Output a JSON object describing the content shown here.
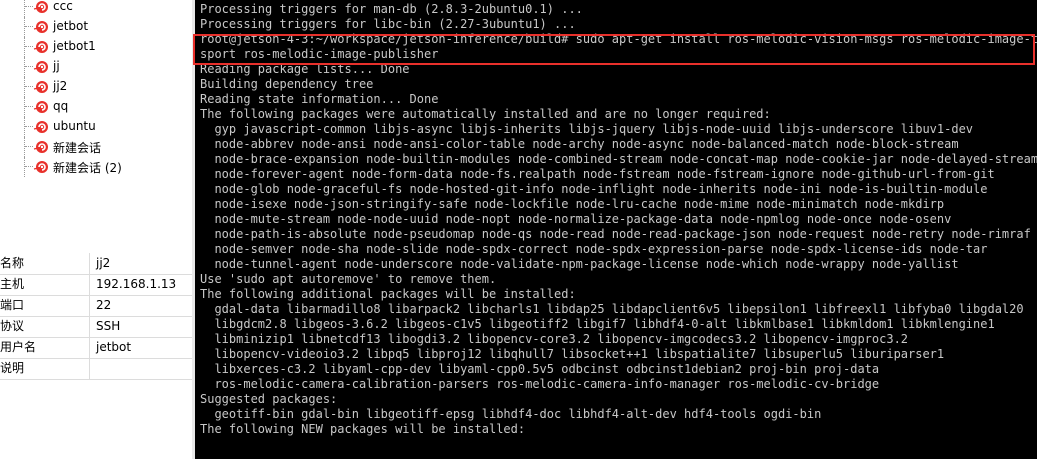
{
  "sidebar": {
    "sessions": [
      "ccc",
      "jetbot",
      "jetbot1",
      "jj",
      "jj2",
      "qq",
      "ubuntu",
      "新建会话",
      "新建会话 (2)"
    ]
  },
  "properties": [
    {
      "key": "名称",
      "value": "jj2"
    },
    {
      "key": "主机",
      "value": "192.168.1.13"
    },
    {
      "key": "端口",
      "value": "22"
    },
    {
      "key": "协议",
      "value": "SSH"
    },
    {
      "key": "用户名",
      "value": "jetbot"
    },
    {
      "key": "说明",
      "value": ""
    }
  ],
  "terminal": {
    "lines": [
      "Processing triggers for man-db (2.8.3-2ubuntu0.1) ...",
      "Processing triggers for libc-bin (2.27-3ubuntu1) ...",
      "root@jetson-4-3:~/workspace/jetson-inference/build# sudo apt-get install ros-melodic-vision-msgs ros-melodic-image-tran",
      "sport ros-melodic-image-publisher",
      "Reading package lists... Done",
      "Building dependency tree",
      "Reading state information... Done",
      "The following packages were automatically installed and are no longer required:",
      "  gyp javascript-common libjs-async libjs-inherits libjs-jquery libjs-node-uuid libjs-underscore libuv1-dev",
      "  node-abbrev node-ansi node-ansi-color-table node-archy node-async node-balanced-match node-block-stream",
      "  node-brace-expansion node-builtin-modules node-combined-stream node-concat-map node-cookie-jar node-delayed-stream",
      "  node-forever-agent node-form-data node-fs.realpath node-fstream node-fstream-ignore node-github-url-from-git",
      "  node-glob node-graceful-fs node-hosted-git-info node-inflight node-inherits node-ini node-is-builtin-module",
      "  node-isexe node-json-stringify-safe node-lockfile node-lru-cache node-mime node-minimatch node-mkdirp",
      "  node-mute-stream node-node-uuid node-nopt node-normalize-package-data node-npmlog node-once node-osenv",
      "  node-path-is-absolute node-pseudomap node-qs node-read node-read-package-json node-request node-retry node-rimraf",
      "  node-semver node-sha node-slide node-spdx-correct node-spdx-expression-parse node-spdx-license-ids node-tar",
      "  node-tunnel-agent node-underscore node-validate-npm-package-license node-which node-wrappy node-yallist",
      "Use 'sudo apt autoremove' to remove them.",
      "The following additional packages will be installed:",
      "  gdal-data libarmadillo8 libarpack2 libcharls1 libdap25 libdapclient6v5 libepsilon1 libfreexl1 libfyba0 libgdal20",
      "  libgdcm2.8 libgeos-3.6.2 libgeos-c1v5 libgeotiff2 libgif7 libhdf4-0-alt libkmlbase1 libkmldom1 libkmlengine1",
      "  libminizip1 libnetcdf13 libogdi3.2 libopencv-core3.2 libopencv-imgcodecs3.2 libopencv-imgproc3.2",
      "  libopencv-videoio3.2 libpq5 libproj12 libqhull7 libsocket++1 libspatialite7 libsuperlu5 liburiparser1",
      "  libxerces-c3.2 libyaml-cpp-dev libyaml-cpp0.5v5 odbcinst odbcinst1debian2 proj-bin proj-data",
      "  ros-melodic-camera-calibration-parsers ros-melodic-camera-info-manager ros-melodic-cv-bridge",
      "Suggested packages:",
      "  geotiff-bin gdal-bin libgeotiff-epsg libhdf4-doc libhdf4-alt-dev hdf4-tools ogdi-bin",
      "The following NEW packages will be installed:"
    ]
  },
  "colors": {
    "terminal_bg": "#000000",
    "terminal_fg": "#c8c8c8",
    "highlight": "#e8302b",
    "session_icon": "#e8302b"
  }
}
